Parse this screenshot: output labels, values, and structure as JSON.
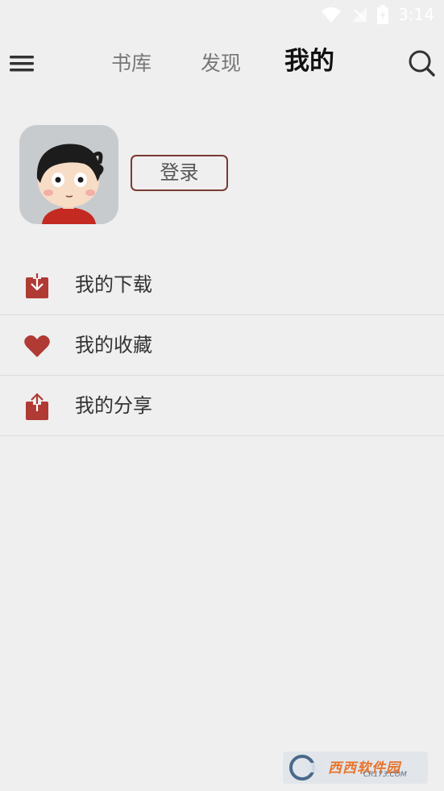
{
  "status_bar": {
    "time": "3:14",
    "icons": [
      "wifi-icon",
      "signal-icon",
      "battery-charging-icon"
    ]
  },
  "top_nav": {
    "tabs": [
      {
        "label": "书库",
        "active": false
      },
      {
        "label": "发现",
        "active": false
      },
      {
        "label": "我的",
        "active": true
      }
    ],
    "left_icon": "hamburger-menu-icon",
    "right_icon": "search-icon"
  },
  "profile": {
    "avatar": "default-cartoon-avatar",
    "login_label": "登录"
  },
  "menu": [
    {
      "label": "我的下载",
      "icon": "download-icon"
    },
    {
      "label": "我的收藏",
      "icon": "heart-icon"
    },
    {
      "label": "我的分享",
      "icon": "share-icon"
    }
  ],
  "colors": {
    "background": "#efefef",
    "accent": "#b03a34",
    "login_border": "#7a3a32",
    "active_tab": "#111111",
    "inactive_tab": "#777777"
  },
  "watermark": {
    "text": "西西软件园",
    "sub": "CR173.COM"
  }
}
